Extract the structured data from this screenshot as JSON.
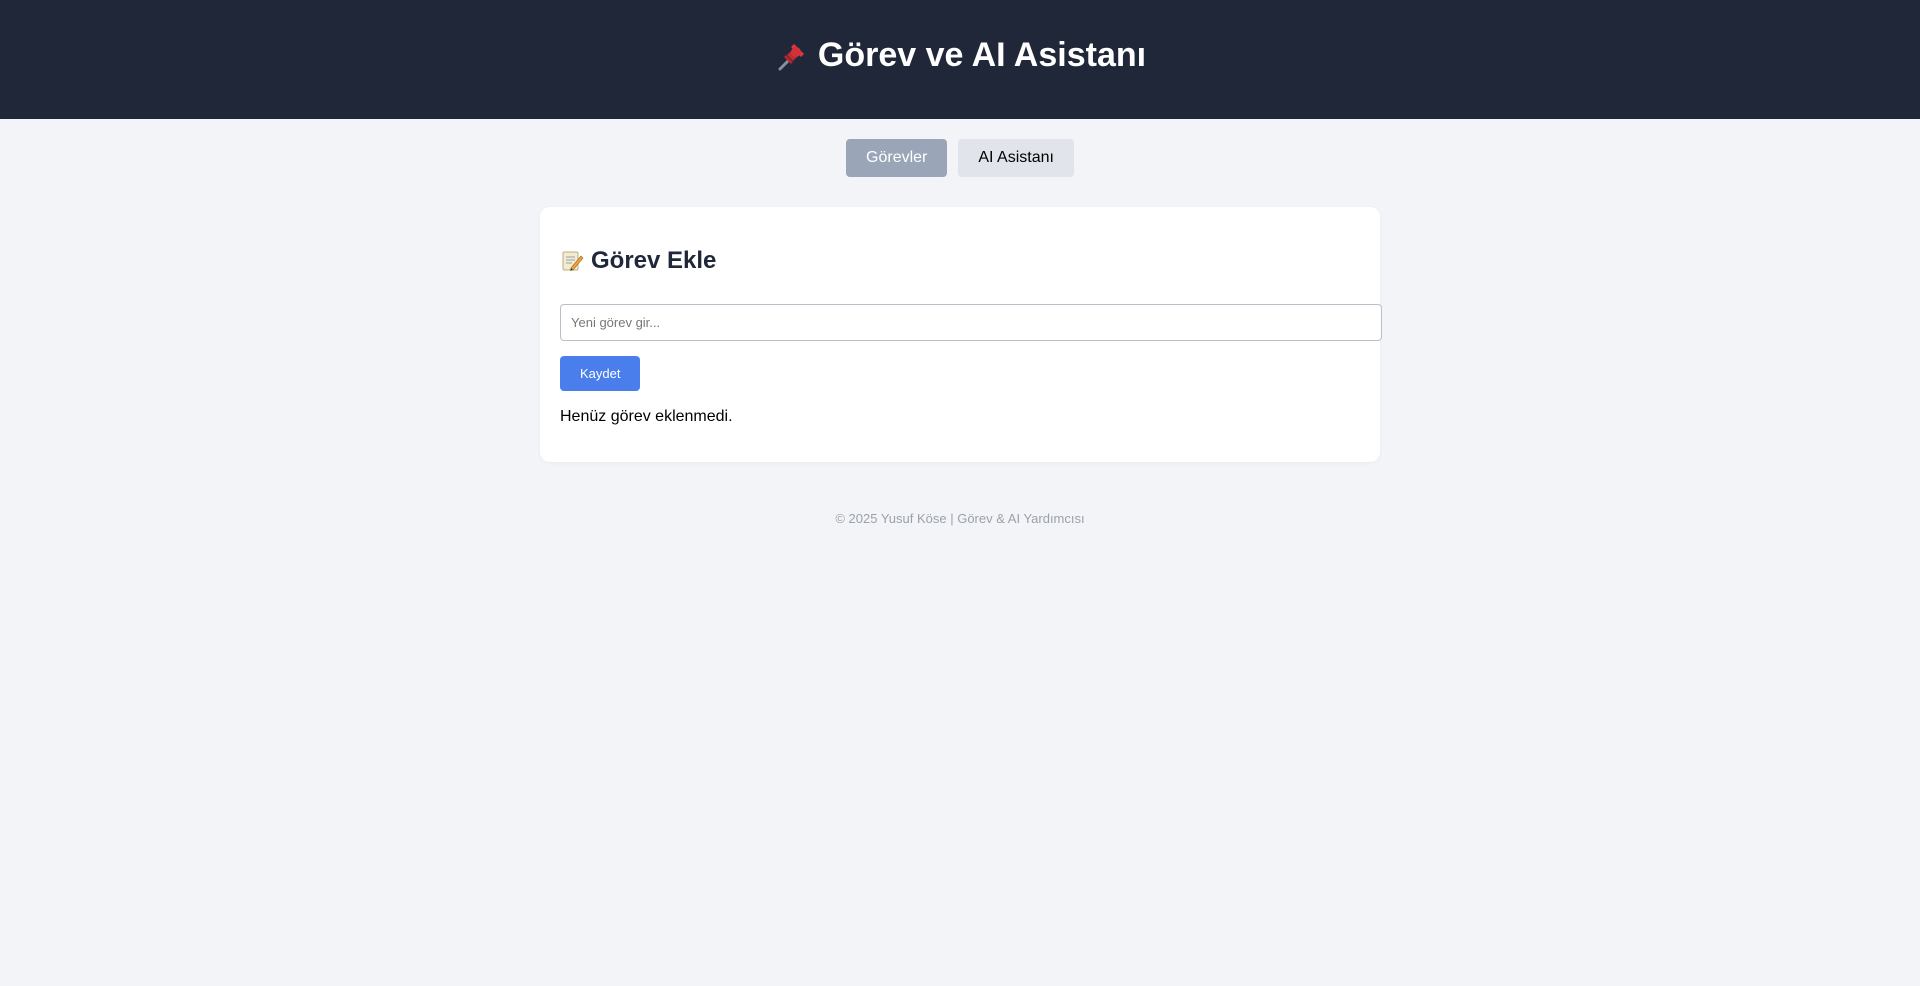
{
  "header": {
    "title": "Görev ve AI Asistanı",
    "icon": "pushpin-icon"
  },
  "tabs": [
    {
      "label": "Görevler",
      "active": true
    },
    {
      "label": "AI Asistanı",
      "active": false
    }
  ],
  "task_card": {
    "heading": "Görev Ekle",
    "heading_icon": "memo-icon",
    "input": {
      "placeholder": "Yeni görev gir...",
      "value": ""
    },
    "save_label": "Kaydet",
    "empty_message": "Henüz görev eklenmedi."
  },
  "footer": {
    "text": "© 2025 Yusuf Köse | Görev & AI Yardımcısı"
  },
  "colors": {
    "header_bg": "#1f2738",
    "page_bg": "#f2f4f7",
    "accent": "#4a7eed",
    "tab_active_bg": "#9aa5b8",
    "tab_inactive_bg": "#e1e5eb"
  }
}
